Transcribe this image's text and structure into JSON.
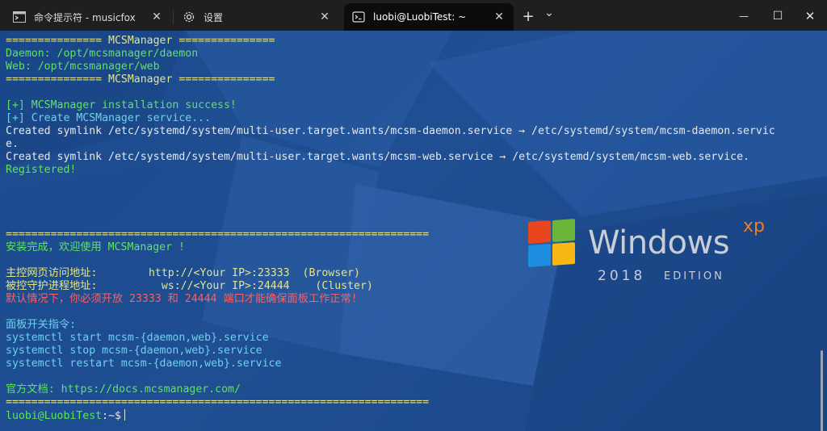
{
  "tabs": [
    {
      "label": "命令提示符 - musicfox",
      "icon": "cmd-icon",
      "active": false
    },
    {
      "label": "设置",
      "icon": "gear-icon",
      "active": false
    },
    {
      "label": "luobi@LuobiTest: ~",
      "icon": "linux-terminal-icon",
      "active": true
    }
  ],
  "toolbar": {
    "new_tab_glyph": "+",
    "dropdown_glyph": "⌄",
    "close_glyph": "✕",
    "min_glyph": "—",
    "max_glyph": "☐"
  },
  "terminal": {
    "lines": [
      {
        "text": "=============== MCSManager ===============",
        "color": "yellow"
      },
      {
        "text": "Daemon: /opt/mcsmanager/daemon",
        "color": "green"
      },
      {
        "text": "Web: /opt/mcsmanager/web",
        "color": "green"
      },
      {
        "text": "=============== MCSManager ===============",
        "color": "yellow"
      },
      {
        "text": "",
        "color": "white"
      },
      {
        "text": "[+] MCSManager installation success!",
        "color": "green"
      },
      {
        "text": "[+] Create MCSManager service...",
        "color": "cyan"
      },
      {
        "text": "Created symlink /etc/systemd/system/multi-user.target.wants/mcsm-daemon.service → /etc/systemd/system/mcsm-daemon.servic",
        "color": "white"
      },
      {
        "text": "e.",
        "color": "white"
      },
      {
        "text": "Created symlink /etc/systemd/system/multi-user.target.wants/mcsm-web.service → /etc/systemd/system/mcsm-web.service.",
        "color": "white"
      },
      {
        "text": "Registered!",
        "color": "green"
      },
      {
        "text": "",
        "color": "white"
      },
      {
        "text": "",
        "color": "white"
      },
      {
        "text": "",
        "color": "white"
      },
      {
        "text": "",
        "color": "white"
      },
      {
        "text": "==================================================================",
        "color": "yellow"
      },
      {
        "text": "安装完成，欢迎使用 MCSManager !",
        "color": "green"
      },
      {
        "text": "",
        "color": "white"
      },
      {
        "text": "主控网页访问地址:        http://<Your IP>:23333  (Browser)",
        "color": "yellow"
      },
      {
        "text": "被控守护进程地址:          ws://<Your IP>:24444    (Cluster)",
        "color": "yellow"
      },
      {
        "text": "默认情况下，你必须开放 23333 和 24444 端口才能确保面板工作正常!",
        "color": "red"
      },
      {
        "text": "",
        "color": "white"
      },
      {
        "text": "面板开关指令:",
        "color": "cyan"
      },
      {
        "text": "systemctl start mcsm-{daemon,web}.service",
        "color": "cyan"
      },
      {
        "text": "systemctl stop mcsm-{daemon,web}.service",
        "color": "cyan"
      },
      {
        "text": "systemctl restart mcsm-{daemon,web}.service",
        "color": "cyan"
      },
      {
        "text": "",
        "color": "white"
      },
      {
        "text": "官方文档: https://docs.mcsmanager.com/",
        "color": "green"
      },
      {
        "text": "==================================================================",
        "color": "yellow"
      }
    ],
    "prompt_user": "luobi@LuobiTest",
    "prompt_path": ":~$"
  },
  "wallpaper": {
    "word": "Windows",
    "superscript": "xp",
    "year": "2018",
    "edition": "EDITION",
    "colors": {
      "red": "#e8461e",
      "green": "#6cb43a",
      "blue": "#1e8fe0",
      "yellow": "#f7b813"
    }
  }
}
